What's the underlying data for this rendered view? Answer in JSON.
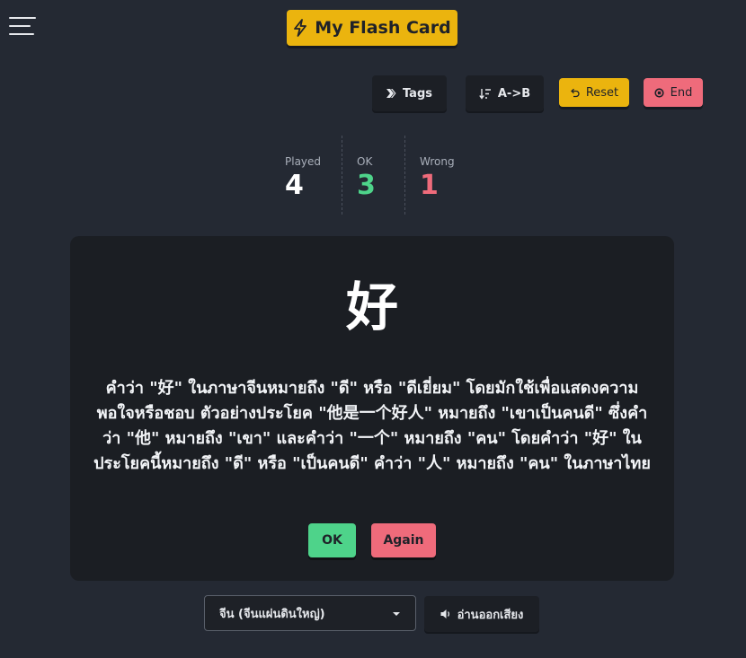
{
  "header": {
    "menu_icon": "hamburger-menu-icon",
    "title": "My Flash Card",
    "title_icon": "lightning-bolt-icon"
  },
  "toolbar": {
    "tags_label": "Tags",
    "tags_icon": "double-chevron-right-icon",
    "sort_label": "A->B",
    "sort_icon": "sort-ascending-icon",
    "reset_label": "Reset",
    "reset_icon": "undo-icon",
    "end_label": "End",
    "end_icon": "stop-circle-icon"
  },
  "stats": {
    "played_label": "Played",
    "played_value": "4",
    "ok_label": "OK",
    "ok_value": "3",
    "wrong_label": "Wrong",
    "wrong_value": "1"
  },
  "card": {
    "character": "好",
    "description": "คำว่า \"好\" ในภาษาจีนหมายถึง \"ดี\" หรือ \"ดีเยี่ยม\" โดยมักใช้เพื่อแสดงความพอใจหรือชอบ ตัวอย่างประโยค \"他是一个好人\" หมายถึง \"เขาเป็นคนดี\" ซึ่งคำว่า \"他\" หมายถึง \"เขา\" และคำว่า \"一个\" หมายถึง \"คน\" โดยคำว่า \"好\" ในประโยคนี้หมายถึง \"ดี\" หรือ \"เป็นคนดี\" คำว่า \"人\" หมายถึง \"คน\" ในภาษาไทย",
    "ok_label": "OK",
    "again_label": "Again"
  },
  "footer": {
    "language_selected": "จีน (จีนแผ่นดินใหญ่)",
    "speak_label": "อ่านออกเสียง",
    "speak_icon": "speaker-icon"
  },
  "colors": {
    "background": "#242933",
    "accent_yellow": "#ebb40e",
    "accent_red": "#ef6b7b",
    "accent_green": "#4ed38a",
    "card_background": "#1b1e23"
  }
}
